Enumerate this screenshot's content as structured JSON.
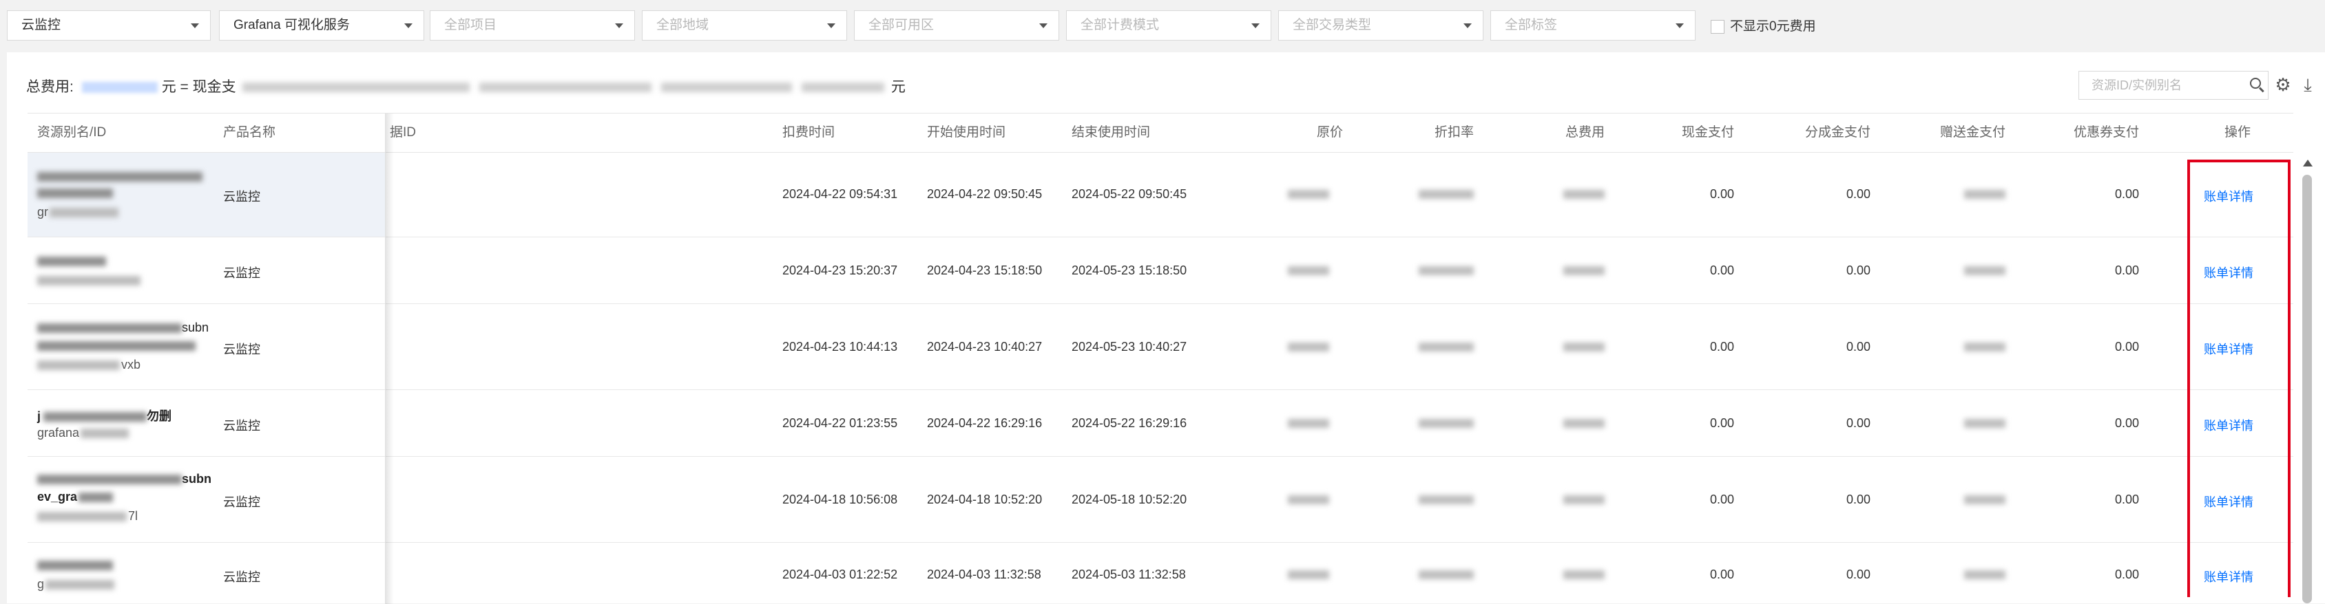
{
  "filters": {
    "product": "云监控",
    "service": "Grafana 可视化服务",
    "project_ph": "全部项目",
    "region_ph": "全部地域",
    "zone_ph": "全部可用区",
    "billing_mode_ph": "全部计费模式",
    "transaction_type_ph": "全部交易类型",
    "tag_ph": "全部标签",
    "hide_zero_label": "不显示0元费用"
  },
  "summary": {
    "label": "总费用:",
    "suffix": "元",
    "equals_cash": "= 现金支",
    "tail": "元"
  },
  "search": {
    "placeholder": "资源ID/实例别名"
  },
  "icons": [
    "search-icon",
    "gear-icon",
    "download-icon"
  ],
  "columns": {
    "resource": "资源别名/ID",
    "product": "产品名称",
    "instance_id": "据ID",
    "deduct_time": "扣费时间",
    "start_time": "开始使用时间",
    "end_time": "结束使用时间",
    "price": "原价",
    "discount": "折扣率",
    "total": "总费用",
    "cash": "现金支付",
    "share": "分成金支付",
    "gift": "赠送金支付",
    "voucher": "优惠券支付",
    "action": "操作"
  },
  "rows": [
    {
      "product": "云监控",
      "deduct": "2024-04-22 09:54:31",
      "start": "2024-04-22 09:50:45",
      "end": "2024-05-22 09:50:45",
      "cash": "0.00",
      "share": "0.00",
      "voucher": "0.00",
      "action": "账单详情",
      "name_line": "gr"
    },
    {
      "product": "云监控",
      "deduct": "2024-04-23 15:20:37",
      "start": "2024-04-23 15:18:50",
      "end": "2024-05-23 15:18:50",
      "cash": "0.00",
      "share": "0.00",
      "voucher": "0.00",
      "action": "账单详情",
      "name_line": ""
    },
    {
      "product": "云监控",
      "deduct": "2024-04-23 10:44:13",
      "start": "2024-04-23 10:40:27",
      "end": "2024-05-23 10:40:27",
      "cash": "0.00",
      "share": "0.00",
      "voucher": "0.00",
      "action": "账单详情",
      "name_line": "subn",
      "id_line": "vxb"
    },
    {
      "product": "云监控",
      "deduct": "2024-04-22 01:23:55",
      "start": "2024-04-22 16:29:16",
      "end": "2024-05-22 16:29:16",
      "cash": "0.00",
      "share": "0.00",
      "voucher": "0.00",
      "action": "账单详情",
      "name_line": "j",
      "name_tail": "勿删",
      "id_line": "grafana"
    },
    {
      "product": "云监控",
      "deduct": "2024-04-18 10:56:08",
      "start": "2024-04-18 10:52:20",
      "end": "2024-05-18 10:52:20",
      "cash": "0.00",
      "share": "0.00",
      "voucher": "0.00",
      "action": "账单详情",
      "name_line": "subn",
      "name_line2": "ev_gra",
      "id_line": "7l"
    },
    {
      "product": "云监控",
      "deduct": "2024-04-03 01:22:52",
      "start": "2024-04-03 11:32:58",
      "end": "2024-05-03 11:32:58",
      "cash": "0.00",
      "share": "0.00",
      "voucher": "0.00",
      "action": "账单详情",
      "name_line": "g"
    }
  ],
  "colors": {
    "link": "#006eff",
    "highlight_box": "#e0001b"
  }
}
